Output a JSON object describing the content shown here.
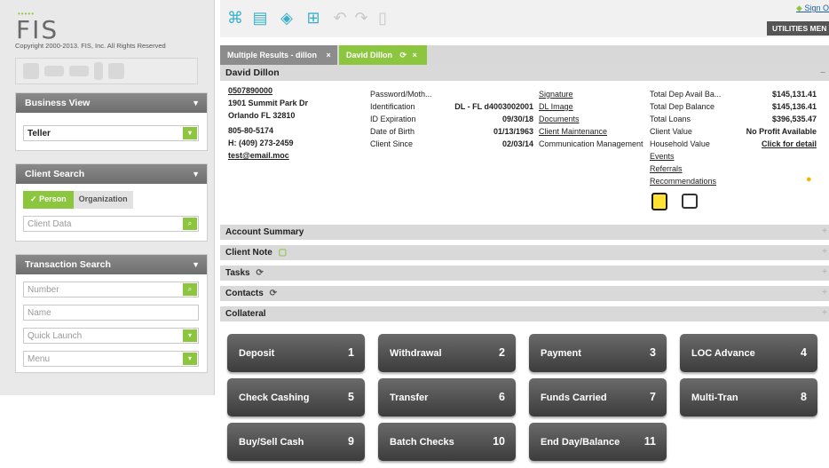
{
  "logo": {
    "text": "FIS",
    "dots": "•••••"
  },
  "copyright": "Copyright 2000-2013. FIS, Inc. All Rights Reserved",
  "business_view": {
    "title": "Business View",
    "selected": "Teller"
  },
  "client_search": {
    "title": "Client Search",
    "person_label": "Person",
    "organization_label": "Organization",
    "client_data_placeholder": "Client Data"
  },
  "transaction_search": {
    "title": "Transaction Search",
    "number_placeholder": "Number",
    "name_placeholder": "Name",
    "quick_launch": "Quick Launch",
    "menu": "Menu"
  },
  "header": {
    "sign_on": "Sign O",
    "utilities_menu": "UTILITIES MEN"
  },
  "tabs": [
    {
      "label": "Multiple Results - dillon",
      "close": "×"
    },
    {
      "label": "David Dillon",
      "refresh": "⟳",
      "close": "×"
    }
  ],
  "customer": {
    "name": "David Dillon",
    "minimize": "–",
    "account_number": "0507890000",
    "address1": "1901 Summit Park Dr",
    "address2": "Orlando FL 32810",
    "ssn": "805-80-5174",
    "home_phone": "H: (409) 273-2459",
    "email": "test@email.moc",
    "fields": [
      {
        "label": "Password/Moth...",
        "value": ""
      },
      {
        "label": "Identification",
        "value": "DL - FL d4003002001"
      },
      {
        "label": "ID Expiration",
        "value": "09/30/18"
      },
      {
        "label": "Date of Birth",
        "value": "01/13/1963"
      },
      {
        "label": "Client Since",
        "value": "02/03/14"
      }
    ],
    "links": [
      "Signature",
      "DL Image",
      "Documents",
      "Client Maintenance",
      "Communication Management"
    ],
    "totals": [
      {
        "label": "Total Dep Avail Ba...",
        "value": "$145,131.41"
      },
      {
        "label": "Total Dep Balance",
        "value": "$145,136.41"
      },
      {
        "label": "Total Loans",
        "value": "$396,535.47"
      },
      {
        "label": "Client Value",
        "value": "No Profit Available"
      },
      {
        "label": "Household Value",
        "value": "Click for detail"
      }
    ],
    "extra_links": [
      "Events",
      "Referrals",
      "Recommendations"
    ]
  },
  "sections": [
    {
      "label": "Account Summary"
    },
    {
      "label": "Client Note"
    },
    {
      "label": "Tasks"
    },
    {
      "label": "Contacts"
    },
    {
      "label": "Collateral"
    }
  ],
  "tiles": [
    {
      "label": "Deposit",
      "num": "1"
    },
    {
      "label": "Withdrawal",
      "num": "2"
    },
    {
      "label": "Payment",
      "num": "3"
    },
    {
      "label": "LOC Advance",
      "num": "4"
    },
    {
      "label": "Check Cashing",
      "num": "5"
    },
    {
      "label": "Transfer",
      "num": "6"
    },
    {
      "label": "Funds Carried",
      "num": "7"
    },
    {
      "label": "Multi-Tran",
      "num": "8"
    },
    {
      "label": "Buy/Sell Cash",
      "num": "9"
    },
    {
      "label": "Batch Checks",
      "num": "10"
    },
    {
      "label": "End Day/Balance",
      "num": "11"
    }
  ],
  "icons": {
    "plus": "+",
    "triangle": "▼",
    "check": "✓",
    "search": "⌕",
    "dropdown": "▾",
    "refresh": "⟳",
    "note": "▢",
    "bulb": "●"
  },
  "colors": {
    "accent": "#8cc63f",
    "tile": "#4a4a4a",
    "header": "#777777"
  }
}
